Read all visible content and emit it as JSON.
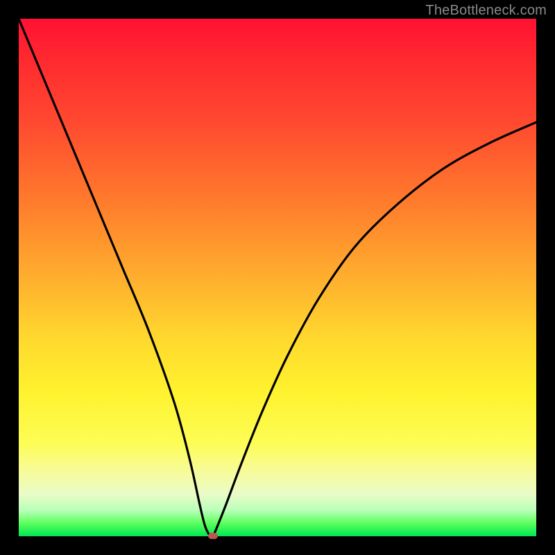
{
  "watermark": "TheBottleneck.com",
  "colors": {
    "frame": "#000000",
    "gradient_top": "#ff1133",
    "gradient_mid": "#ffd92e",
    "gradient_bottom": "#00e756",
    "curve": "#000000",
    "marker": "#c0544e"
  },
  "chart_data": {
    "type": "line",
    "title": "",
    "xlabel": "",
    "ylabel": "",
    "xlim": [
      0,
      100
    ],
    "ylim": [
      0,
      100
    ],
    "grid": false,
    "legend": false,
    "series": [
      {
        "name": "bottleneck-curve",
        "x": [
          0,
          5,
          10,
          15,
          20,
          25,
          30,
          33,
          35,
          36,
          37,
          37.5,
          38,
          40,
          43,
          47,
          52,
          58,
          65,
          73,
          82,
          91,
          100
        ],
        "values": [
          100,
          88,
          76,
          64,
          52,
          40,
          26,
          15,
          6,
          2,
          0,
          0,
          1,
          6,
          14,
          24,
          35,
          46,
          56,
          64,
          71,
          76,
          80
        ]
      }
    ],
    "annotations": [
      {
        "name": "min-marker",
        "x": 37.5,
        "y": 0
      }
    ]
  }
}
